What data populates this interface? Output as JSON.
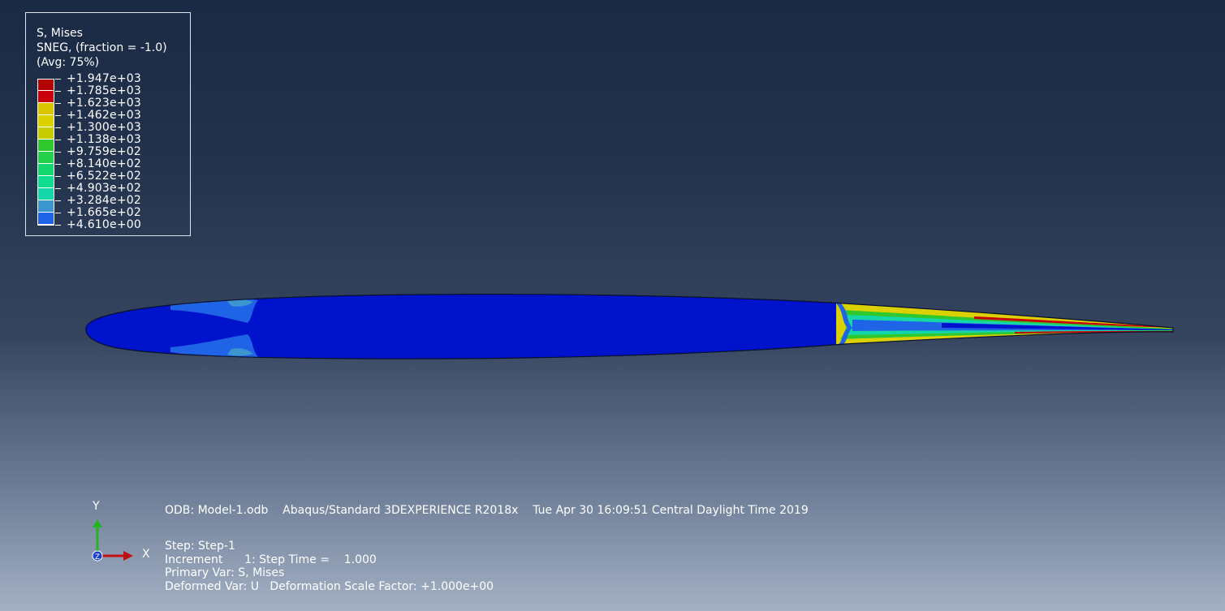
{
  "legend": {
    "title": "S, Mises",
    "subtitle": "SNEG, (fraction = -1.0)",
    "avg": "(Avg: 75%)",
    "levels": [
      {
        "label": "+1.947e+03",
        "color": "#b30000"
      },
      {
        "label": "+1.785e+03",
        "color": "#c8000c"
      },
      {
        "label": "+1.623e+03",
        "color": "#d9c400"
      },
      {
        "label": "+1.462e+03",
        "color": "#dcd100"
      },
      {
        "label": "+1.300e+03",
        "color": "#c6cc00"
      },
      {
        "label": "+1.138e+03",
        "color": "#2fc82f"
      },
      {
        "label": "+9.759e+02",
        "color": "#25d04a"
      },
      {
        "label": "+8.140e+02",
        "color": "#14d66e"
      },
      {
        "label": "+6.522e+02",
        "color": "#0edd8d"
      },
      {
        "label": "+4.903e+02",
        "color": "#14d6a8"
      },
      {
        "label": "+3.284e+02",
        "color": "#3d95cf"
      },
      {
        "label": "+1.665e+02",
        "color": "#1f63e6"
      },
      {
        "label": "+4.610e+00",
        "color": "#0013cc"
      }
    ]
  },
  "header_line": "ODB: Model-1.odb    Abaqus/Standard 3DEXPERIENCE R2018x    Tue Apr 30 16:09:51 Central Daylight Time 2019",
  "step_info": {
    "step": "Step: Step-1",
    "increment": "Increment      1: Step Time =    1.000",
    "primary_var": "Primary Var: S, Mises",
    "deformed_var": "Deformed Var: U   Deformation Scale Factor: +1.000e+00"
  },
  "triad": {
    "y": "Y",
    "x": "X",
    "z": "Z"
  },
  "colors": {
    "body_blue": "#0013cc",
    "light_blue": "#1f63e6",
    "mid_blue": "#3d95cf",
    "x_axis": "#c01010",
    "y_axis": "#22b522",
    "z_axis": "#1a3fcc"
  }
}
